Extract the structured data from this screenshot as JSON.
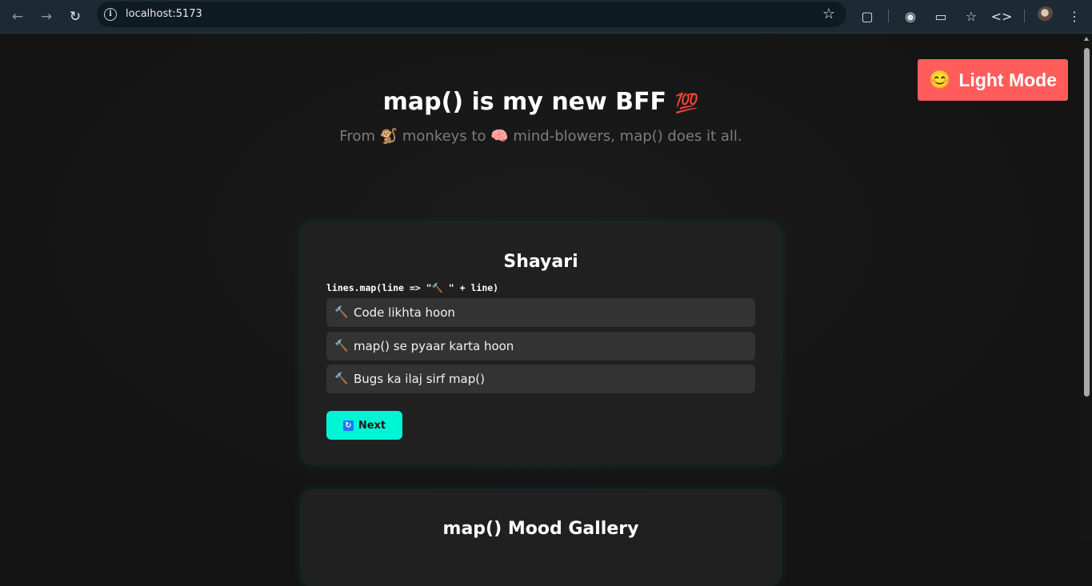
{
  "browser": {
    "url": "localhost:5173"
  },
  "theme_toggle": {
    "emoji": "😊",
    "label": "Light Mode"
  },
  "header": {
    "title": "map() is my new BFF",
    "title_emoji": "💯",
    "subtitle": "From 🐒 monkeys to 🧠 mind-blowers, map() does it all."
  },
  "shayari_card": {
    "title": "Shayari",
    "code": "lines.map(line => \"🔨 \" + line)",
    "marker": "🔨",
    "lines": [
      "Code likhta hoon",
      "map() se pyaar karta hoon",
      "Bugs ka ilaj sirf map()"
    ],
    "next_label": "Next",
    "next_icon": "🔁"
  },
  "gallery_card": {
    "title": "map() Mood Gallery"
  },
  "colors": {
    "background": "#141414",
    "card": "#202020",
    "accent_teal": "#00f5d4",
    "accent_red": "#ff5c5c"
  }
}
